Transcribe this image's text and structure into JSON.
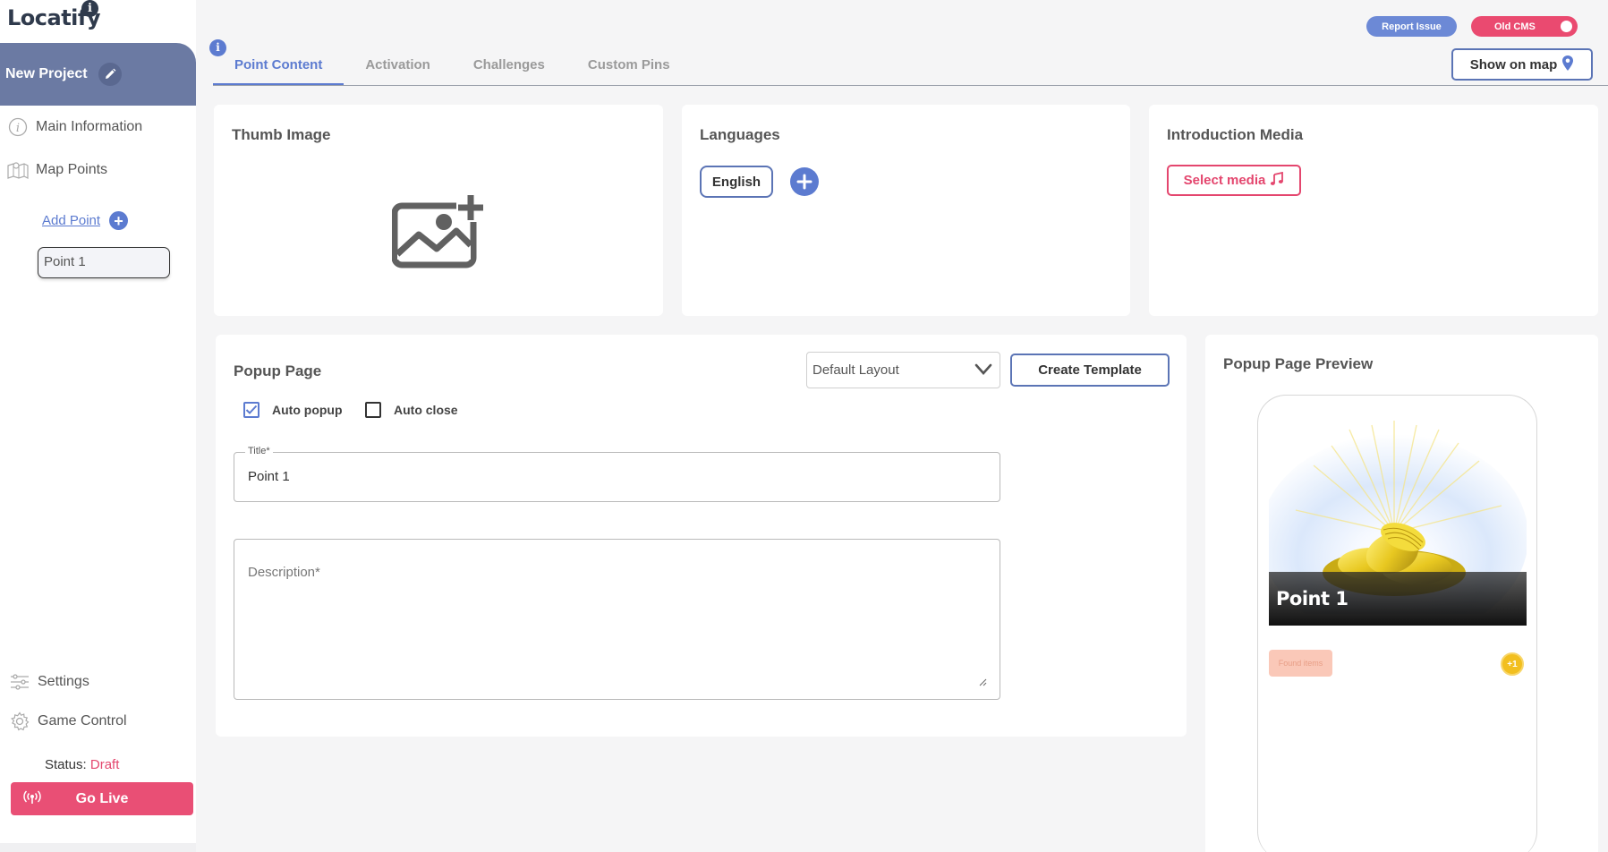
{
  "brand": {
    "logo_text": "Locatify",
    "logo_badge": "i"
  },
  "sidebar": {
    "project_name": "New Project",
    "items": [
      {
        "label": "Main Information",
        "icon": "info-icon"
      },
      {
        "label": "Map Points",
        "icon": "map-icon"
      }
    ],
    "add_point_label": "Add Point",
    "add_point_symbol": "+",
    "points": [
      {
        "label": "Point 1"
      }
    ],
    "bottom_items": [
      {
        "label": "Settings",
        "icon": "sliders-icon"
      },
      {
        "label": "Game Control",
        "icon": "gear-icon"
      }
    ],
    "status_label": "Status:",
    "status_value": "Draft",
    "go_live_label": "Go Live"
  },
  "topbar": {
    "report_issue_label": "Report Issue",
    "old_cms_label": "Old CMS",
    "tabs_info": "i",
    "tabs": [
      {
        "label": "Point Content",
        "active": true
      },
      {
        "label": "Activation",
        "active": false
      },
      {
        "label": "Challenges",
        "active": false
      },
      {
        "label": "Custom Pins",
        "active": false
      }
    ],
    "show_on_map_label": "Show on map"
  },
  "thumb_card": {
    "title": "Thumb Image"
  },
  "languages_card": {
    "title": "Languages",
    "languages": [
      "English"
    ]
  },
  "intro_card": {
    "title": "Introduction Media",
    "select_media_label": "Select media"
  },
  "popup_card": {
    "title": "Popup Page",
    "layout_selected": "Default Layout",
    "create_template_label": "Create Template",
    "auto_popup_label": "Auto popup",
    "auto_popup_checked": true,
    "auto_close_label": "Auto close",
    "auto_close_checked": false,
    "title_field_label": "Title*",
    "title_field_value": "Point 1",
    "description_placeholder": "Description*"
  },
  "preview_card": {
    "title": "Popup Page Preview",
    "point_title": "Point 1",
    "found_items_label": "Found items",
    "coin_badge_label": "+1"
  },
  "colors": {
    "accent_blue": "#5c7bd0",
    "sidebar_header": "#6b7aa3",
    "danger_pink": "#e94f75"
  }
}
